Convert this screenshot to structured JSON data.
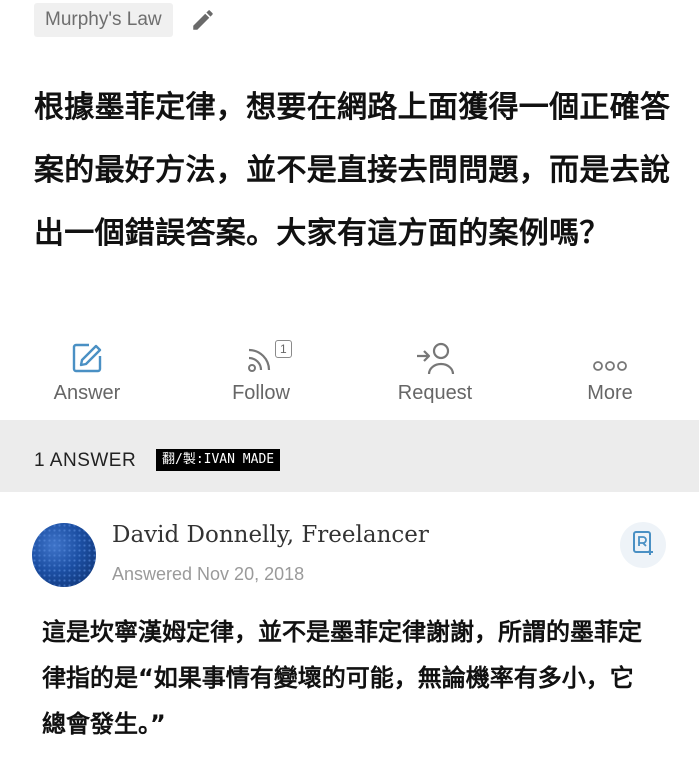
{
  "topic": {
    "label": "Murphy's Law"
  },
  "question": {
    "text": "根據墨菲定律，想要在網路上面獲得一個正確答案的最好方法，並不是直接去問問題，而是去說出一個錯誤答案。大家有這方面的案例嗎？"
  },
  "actions": {
    "answer_label": "Answer",
    "follow_label": "Follow",
    "follow_count": "1",
    "request_label": "Request",
    "more_label": "More"
  },
  "answers_section": {
    "count_label": "1 ANSWER",
    "credit": "翻/製:IVAN MADE"
  },
  "answer": {
    "author": "David Donnelly, Freelancer",
    "date": "Answered Nov 20, 2018",
    "body": "這是坎寧漢姆定律，並不是墨菲定律謝謝，所謂的墨菲定律指的是“如果事情有變壞的可能，無論機率有多小，它總會發生。”"
  },
  "colors": {
    "icon_blue": "#4a90c4",
    "icon_gray": "#777777",
    "section_gray": "#ececec"
  },
  "icons": {
    "edit": "pencil-icon",
    "answer": "edit-square-icon",
    "follow": "rss-icon",
    "request": "add-user-icon",
    "more": "ellipsis-icon",
    "bookmark": "bookmark-add-icon"
  }
}
